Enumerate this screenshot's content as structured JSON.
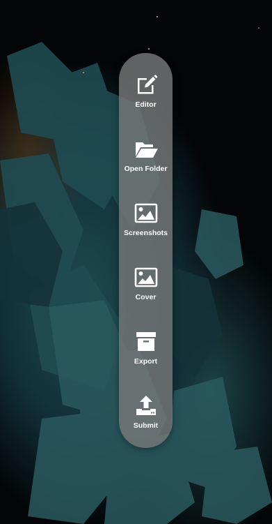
{
  "background": {
    "description_colors": {
      "base": "#030506",
      "crystal_teal": "#1e4a4f",
      "crystal_highlight": "#2c5d60",
      "ember": "#603810"
    }
  },
  "dock": {
    "background_color": "#76787880",
    "items": [
      {
        "label": "Editor",
        "icon": "edit-icon"
      },
      {
        "label": "Open Folder",
        "icon": "folder-open-icon"
      },
      {
        "label": "Screenshots",
        "icon": "image-icon"
      },
      {
        "label": "Cover",
        "icon": "image-icon"
      },
      {
        "label": "Export",
        "icon": "archive-box-icon"
      },
      {
        "label": "Submit",
        "icon": "upload-icon"
      }
    ]
  }
}
